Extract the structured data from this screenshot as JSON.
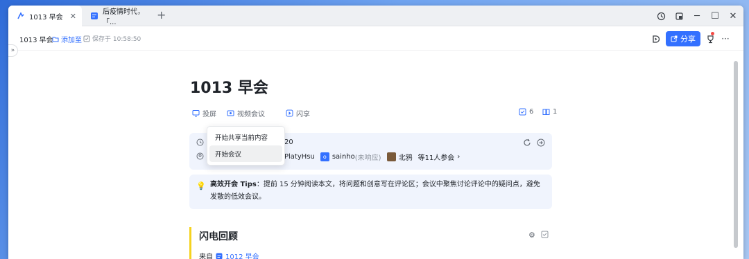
{
  "tabs": [
    {
      "label": "1013 早会",
      "icon": "lark-doc-icon"
    },
    {
      "label": "后疫情时代，「...",
      "icon": "doc-blue-icon"
    }
  ],
  "header": {
    "doc_title": "1013 早会",
    "add_to": "添加至",
    "saved": "保存于 10:58:50",
    "share": "分享"
  },
  "doc": {
    "title": "1013 早会",
    "tools": {
      "cast": "投屏",
      "video": "视频会议",
      "flash": "闪享"
    },
    "task_count": "6",
    "read_count": "1"
  },
  "meeting": {
    "time_tail": "20",
    "attendees": [
      {
        "name": "PlatyHsu",
        "status": ""
      },
      {
        "name": "sainho",
        "status": "(未响应)",
        "avatar_letter": "o"
      },
      {
        "name": "北鸦",
        "status": ""
      }
    ],
    "more": "等11人参会"
  },
  "tips": {
    "label": "高效开会 Tips",
    "text": "：提前 15 分钟阅读本文，将问题和创意写在评论区；会议中聚焦讨论评论中的疑问点，避免发散的低效会议。"
  },
  "section": {
    "title": "闪电回顾",
    "from_label": "来自",
    "from_link": "1012 早会"
  },
  "menu": {
    "items": [
      "开始共享当前内容",
      "开始会议"
    ]
  },
  "colors": {
    "accent": "#3370ff",
    "highlight": "#f5d21f"
  }
}
